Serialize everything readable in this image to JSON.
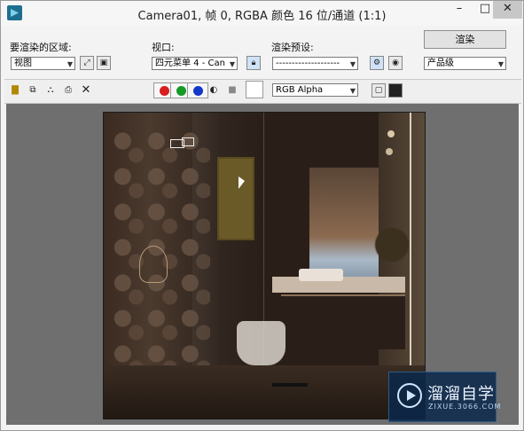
{
  "window": {
    "title": "Camera01, 帧 0, RGBA 颜色 16 位/通道 (1:1)",
    "minimize_label": "–",
    "maximize_label": "□",
    "close_label": "✕"
  },
  "area_to_render": {
    "label": "要渲染的区域:",
    "value": "视图"
  },
  "viewport": {
    "label": "视口:",
    "value": "四元菜单 4 - Can"
  },
  "render_preset": {
    "label": "渲染预设:",
    "value": "--------------------"
  },
  "render_button": {
    "label": "渲染"
  },
  "production": {
    "value": "产品级"
  },
  "channel": {
    "value": "RGB Alpha"
  },
  "colors": {
    "red": "#d81e1e",
    "green": "#159a26",
    "blue": "#1438c8",
    "scene_bg": "#2a1f18"
  },
  "watermark": {
    "name": "溜溜自学",
    "url": "ZIXUE.3066.COM"
  },
  "icons": [
    "save-icon",
    "copy-icon",
    "clone-icon",
    "print-icon",
    "clear-icon",
    "lock-icon",
    "render-setup-icon",
    "environment-icon",
    "alpha-icon",
    "mono-icon",
    "display-toggle-icon"
  ]
}
